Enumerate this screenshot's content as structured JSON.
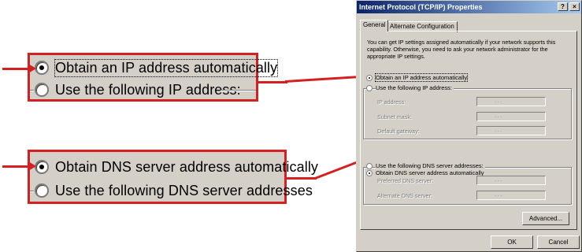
{
  "callouts": {
    "ip": {
      "option1": "Obtain an IP address automatically",
      "option2": "Use the following IP address:"
    },
    "dns": {
      "option1": "Obtain DNS server address automatically",
      "option2": "Use the following DNS server addresses"
    }
  },
  "dialog": {
    "title": "Internet Protocol (TCP/IP) Properties",
    "help_label": "?",
    "close_label": "×",
    "tabs": [
      "General",
      "Alternate Configuration"
    ],
    "intro": "You can get IP settings assigned automatically if your network supports this capability. Otherwise, you need to ask your network administrator for the appropriate IP settings.",
    "ip_auto": "Obtain an IP address automatically",
    "ip_manual": "Use the following IP address:",
    "ip_fields": [
      "IP address:",
      "Subnet mask:",
      "Default gateway:"
    ],
    "dns_auto": "Obtain DNS server address automatically",
    "dns_manual": "Use the following DNS server addresses:",
    "dns_fields": [
      "Preferred DNS server:",
      "Alternate DNS server:"
    ],
    "ip_dots": ".   .   .",
    "advanced_label": "Advanced...",
    "ok_label": "OK",
    "cancel_label": "Cancel"
  },
  "colors": {
    "callout_border": "#d42020",
    "arrow": "#d42020",
    "dialog_face": "#d4d0c8",
    "title_start": "#0a246a",
    "title_end": "#a6caf0"
  }
}
